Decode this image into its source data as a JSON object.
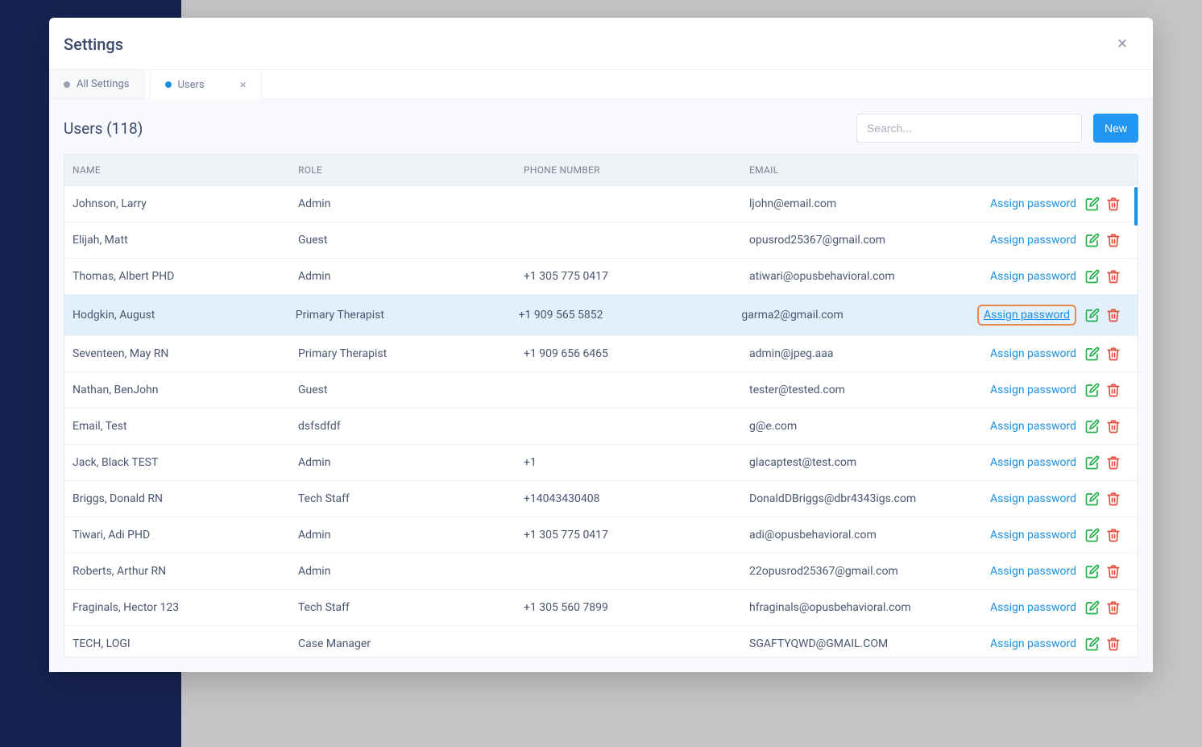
{
  "modal": {
    "title": "Settings",
    "close_icon": "×"
  },
  "tabs": [
    {
      "label": "All Settings",
      "active": false,
      "closable": false
    },
    {
      "label": "Users",
      "active": true,
      "closable": true
    }
  ],
  "table": {
    "title": "Users (118)",
    "search_placeholder": "Search...",
    "new_button": "New",
    "headers": {
      "name": "NAME",
      "role": "ROLE",
      "phone": "PHONE NUMBER",
      "email": "EMAIL"
    },
    "assign_password_label": "Assign password",
    "rows": [
      {
        "name": "Johnson, Larry",
        "role": "Admin",
        "phone": "",
        "email": "ljohn@email.com",
        "highlighted": false
      },
      {
        "name": "Elijah, Matt",
        "role": "Guest",
        "phone": "",
        "email": "opusrod25367@gmail.com",
        "highlighted": false
      },
      {
        "name": "Thomas, Albert PHD",
        "role": "Admin",
        "phone": "+1 305 775 0417",
        "email": "atiwari@opusbehavioral.com",
        "highlighted": false
      },
      {
        "name": "Hodgkin, August",
        "role": "Primary Therapist",
        "phone": "+1 909 565 5852",
        "email": "garma2@gmail.com",
        "highlighted": true
      },
      {
        "name": "Seventeen, May RN",
        "role": "Primary Therapist",
        "phone": "+1 909 656 6465",
        "email": "admin@jpeg.aaa",
        "highlighted": false
      },
      {
        "name": "Nathan, BenJohn",
        "role": "Guest",
        "phone": "",
        "email": "tester@tested.com",
        "highlighted": false
      },
      {
        "name": "Email, Test",
        "role": "dsfsdfdf",
        "phone": "",
        "email": "g@e.com",
        "highlighted": false
      },
      {
        "name": "Jack, Black TEST",
        "role": "Admin",
        "phone": "+1",
        "email": "glacaptest@test.com",
        "highlighted": false
      },
      {
        "name": "Briggs, Donald RN",
        "role": "Tech Staff",
        "phone": "+14043430408",
        "email": "DonaldDBriggs@dbr4343igs.com",
        "highlighted": false
      },
      {
        "name": "Tiwari, Adi PHD",
        "role": "Admin",
        "phone": "+1 305 775 0417",
        "email": "adi@opusbehavioral.com",
        "highlighted": false
      },
      {
        "name": "Roberts, Arthur RN",
        "role": "Admin",
        "phone": "",
        "email": "22opusrod25367@gmail.com",
        "highlighted": false
      },
      {
        "name": "Fraginals, Hector 123",
        "role": "Tech Staff",
        "phone": "+1 305 560 7899",
        "email": "hfraginals@opusbehavioral.com",
        "highlighted": false
      },
      {
        "name": "TECH, LOGI",
        "role": "Case Manager",
        "phone": "",
        "email": "SGAFTYQWD@GMAIL.COM",
        "highlighted": false
      }
    ]
  }
}
